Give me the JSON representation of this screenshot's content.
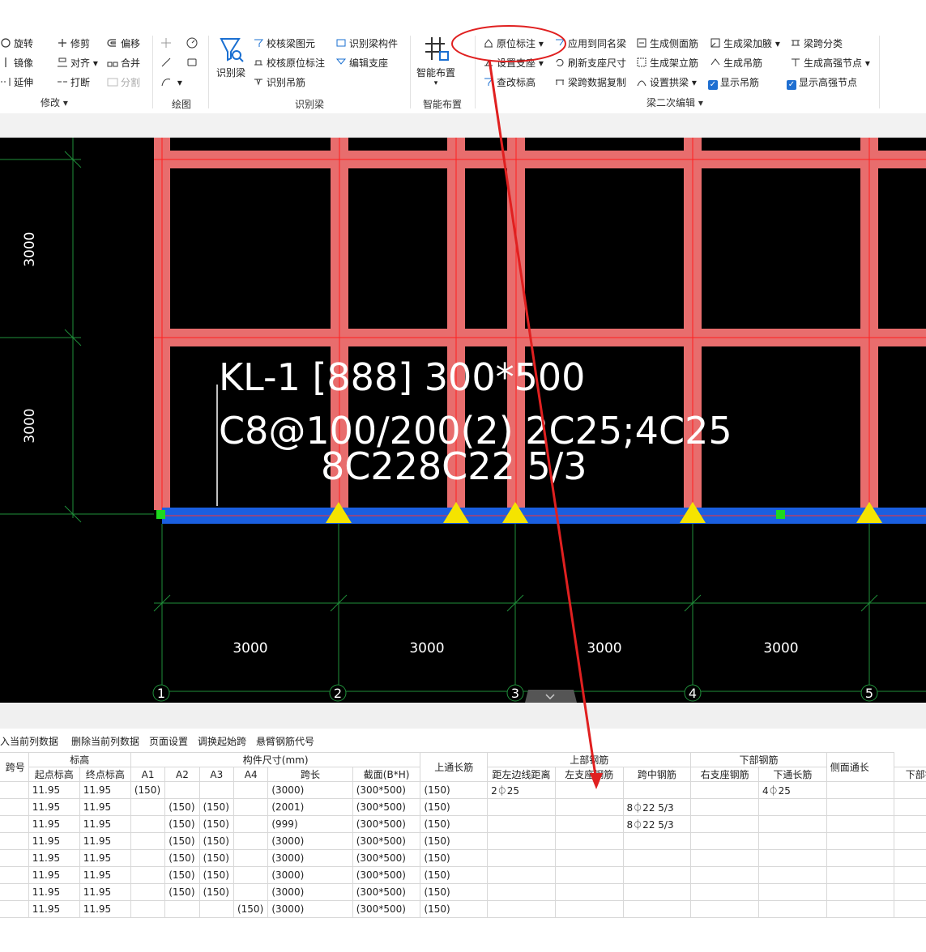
{
  "ribbon": {
    "modify": {
      "rotate": "旋转",
      "trim": "修剪",
      "offset": "偏移",
      "mirror": "镜像",
      "align": "对齐",
      "merge": "合并",
      "extend": "延伸",
      "break": "打断",
      "split": "分割",
      "group_label": "修改"
    },
    "draw": {
      "group_label": "绘图"
    },
    "recognize": {
      "recognize_beam": "识别梁",
      "check_beam_drawing": "校核梁图元",
      "recognize_beam_member": "识别梁构件",
      "check_in_situ": "校核原位标注",
      "edit_support": "编辑支座",
      "recognize_hanger": "识别吊筋",
      "group_label": "识别梁"
    },
    "smart": {
      "button": "智能布置",
      "group_label": "智能布置"
    },
    "secondary": {
      "in_situ": "原位标注",
      "apply_same": "应用到同名梁",
      "gen_side": "生成侧面筋",
      "gen_haunch": "生成梁加腋",
      "span_classify": "梁跨分类",
      "set_support": "设置支座",
      "refresh_support": "刷新支座尺寸",
      "gen_stirrup": "生成架立筋",
      "gen_hanger": "生成吊筋",
      "gen_high_node": "生成高强节点",
      "check_elev": "查改标高",
      "copy_span": "梁跨数据复制",
      "set_arch": "设置拱梁",
      "show_hanger": "显示吊筋",
      "show_high_node": "显示高强节点",
      "group_label": "梁二次编辑"
    }
  },
  "cad": {
    "dim_left_top": "3000",
    "dim_left_bottom": "3000",
    "beam_label_line1": "KL-1 [888] 300*500",
    "beam_label_line2": "C8@100/200(2) 2C25;4C25",
    "beam_label_line3": "8C228C22 5/3",
    "dims_bottom": [
      "3000",
      "3000",
      "3000",
      "3000"
    ],
    "axes": [
      "1",
      "2",
      "3",
      "4",
      "5"
    ]
  },
  "table_toolbar": [
    "插入当前列数据",
    "删除当前列数据",
    "页面设置",
    "调换起始跨",
    "悬臂钢筋代号"
  ],
  "table": {
    "group_headers": {
      "num": "跨号",
      "elev": "标高",
      "size": "构件尺寸(mm)",
      "top_through": "上通长筋",
      "top_rebar": "上部钢筋",
      "bottom_rebar": "下部钢筋",
      "side": "侧面通长"
    },
    "sub_headers": [
      "起点标高",
      "终点标高",
      "A1",
      "A2",
      "A3",
      "A4",
      "跨长",
      "截面(B*H)",
      "距左边线距离",
      "左支座钢筋",
      "跨中钢筋",
      "右支座钢筋",
      "下通长筋",
      "下部钢筋"
    ],
    "rows": [
      [
        "11.95",
        "11.95",
        "(150)",
        "",
        "",
        "",
        "(3000)",
        "(300*500)",
        "(150)",
        "2⏀25",
        "",
        "",
        "",
        "4⏀25",
        "",
        ""
      ],
      [
        "11.95",
        "11.95",
        "",
        "(150)",
        "(150)",
        "",
        "(2001)",
        "(300*500)",
        "(150)",
        "",
        "",
        "8⏀22 5/3",
        "",
        "",
        "",
        ""
      ],
      [
        "11.95",
        "11.95",
        "",
        "(150)",
        "(150)",
        "",
        "(999)",
        "(300*500)",
        "(150)",
        "",
        "",
        "8⏀22 5/3",
        "",
        "",
        "",
        ""
      ],
      [
        "11.95",
        "11.95",
        "",
        "(150)",
        "(150)",
        "",
        "(3000)",
        "(300*500)",
        "(150)",
        "",
        "",
        "",
        "",
        "",
        "",
        ""
      ],
      [
        "11.95",
        "11.95",
        "",
        "(150)",
        "(150)",
        "",
        "(3000)",
        "(300*500)",
        "(150)",
        "",
        "",
        "",
        "",
        "",
        "",
        ""
      ],
      [
        "11.95",
        "11.95",
        "",
        "(150)",
        "(150)",
        "",
        "(3000)",
        "(300*500)",
        "(150)",
        "",
        "",
        "",
        "",
        "",
        "",
        ""
      ],
      [
        "11.95",
        "11.95",
        "",
        "(150)",
        "(150)",
        "",
        "(3000)",
        "(300*500)",
        "(150)",
        "",
        "",
        "",
        "",
        "",
        "",
        ""
      ],
      [
        "11.95",
        "11.95",
        "",
        "",
        "",
        "(150)",
        "(3000)",
        "(300*500)",
        "(150)",
        "",
        "",
        "",
        "",
        "",
        "",
        ""
      ]
    ]
  },
  "colors": {
    "column_fill": "#e86d6d",
    "beam_blue": "#1a5fe0",
    "grid_green": "#1f8f3a",
    "support_yellow": "#f5e400",
    "annotation_red": "#e02020"
  }
}
